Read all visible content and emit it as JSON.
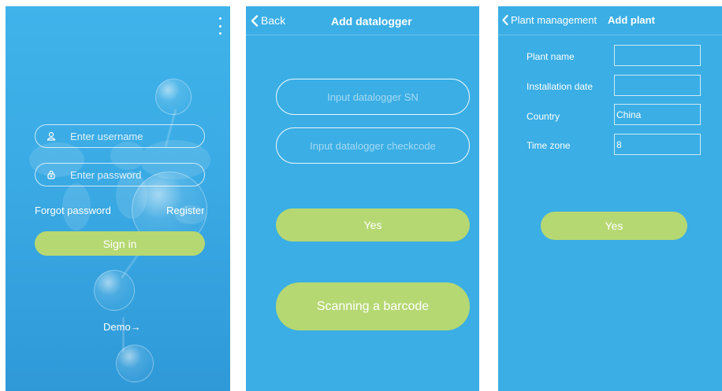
{
  "login": {
    "username_placeholder": "Enter username",
    "password_placeholder": "Enter password",
    "forgot_password": "Forgot password",
    "register": "Register",
    "sign_in": "Sign in",
    "demo": "Demo→",
    "icons": [
      "more-vert-icon",
      "user-icon",
      "lock-icon"
    ]
  },
  "add_datalogger": {
    "back_label": "Back",
    "title": "Add datalogger",
    "sn_placeholder": "Input datalogger SN",
    "checkcode_placeholder": "Input datalogger checkcode",
    "yes": "Yes",
    "scan_barcode": "Scanning a barcode"
  },
  "add_plant": {
    "back_label": "Plant management",
    "title": "Add plant",
    "fields": [
      {
        "label": "Plant name",
        "value": ""
      },
      {
        "label": "Installation date",
        "value": ""
      },
      {
        "label": "Country",
        "value": "China"
      },
      {
        "label": "Time zone",
        "value": "8"
      }
    ],
    "yes": "Yes"
  },
  "colors": {
    "background_blue": "#3aaee5",
    "button_green": "#b6d872",
    "text": "#ffffff"
  }
}
